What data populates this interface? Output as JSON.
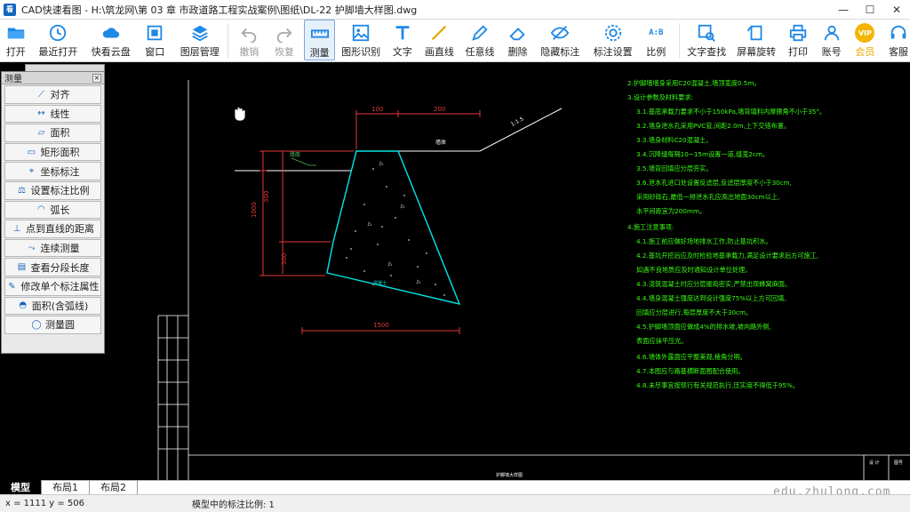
{
  "window": {
    "logo": "看",
    "title": "CAD快速看图 - H:\\筑龙网\\第 03 章 市政道路工程实战案例\\图纸\\DL-22 护脚墙大样图.dwg",
    "min": "—",
    "max": "☐",
    "close": "✕"
  },
  "toolbar": {
    "open": "打开",
    "recent": "最近打开",
    "cloud": "快看云盘",
    "window": "窗口",
    "layers": "图层管理",
    "undo": "撤销",
    "redo": "恢复",
    "measure": "测量",
    "recognize": "图形识别",
    "text": "文字",
    "line": "画直线",
    "freeline": "任意线",
    "delete": "删除",
    "hide_marks": "隐藏标注",
    "mark_settings": "标注设置",
    "scale": "比例",
    "scale_icon_text": "A:B",
    "find_text": "文字查找",
    "rotate": "屏幕旋转",
    "print": "打印",
    "account": "账号",
    "vip": "会员",
    "vip_icon_text": "VIP",
    "service": "客服"
  },
  "measure_panel": {
    "tab_title": "测量",
    "close": "×",
    "items": [
      {
        "label": "对齐",
        "icon": "⟋"
      },
      {
        "label": "线性",
        "icon": "↔"
      },
      {
        "label": "面积",
        "icon": "▱"
      },
      {
        "label": "矩形面积",
        "icon": "▭"
      },
      {
        "label": "坐标标注",
        "icon": "⌖"
      },
      {
        "label": "设置标注比例",
        "icon": "⚖"
      },
      {
        "label": "弧长",
        "icon": "◠"
      },
      {
        "label": "点到直线的距离",
        "icon": "⊥"
      },
      {
        "label": "连续测量",
        "icon": "⤳"
      },
      {
        "label": "查看分段长度",
        "icon": "▤"
      },
      {
        "label": "修改单个标注属性",
        "icon": "✎"
      },
      {
        "label": "面积(含弧线)",
        "icon": "◓"
      },
      {
        "label": "测量圆",
        "icon": "◯"
      }
    ]
  },
  "drawing": {
    "dims": {
      "d1": "100",
      "d2": "200",
      "d3": "300",
      "d4": "1000",
      "d5": "1000",
      "d6": "300",
      "d7": "1500"
    },
    "labels": {
      "l1": "路面",
      "l2": "1:1.5",
      "l3": "墙体",
      "l4": "混凝土"
    },
    "notes": [
      "2.护脚墙墙身采用C20混凝土,墙顶宽度0.5m。",
      "3.设计参数及材料要求:",
      "3.1.基底承载力要求不小于150kPa,墙背填料内摩擦角不小于35°。",
      "3.2.墙身泄水孔采用PVC管,间距2.0m,上下交错布置。",
      "3.3.墙身材料C20混凝土。",
      "3.4.沉降缝每隔10~15m设置一道,缝宽2cm。",
      "3.5.墙背回填应分层夯实。",
      "3.6.泄水孔进口处设置反滤层,反滤层厚度不小于30cm,",
      "    采用砂砾石,最低一排泄水孔应高出地面30cm以上,",
      "    水平间距宜为200mm。",
      "4.施工注意事项:",
      "4.1.施工前应做好场地排水工作,防止基坑积水。",
      "4.2.基坑开挖后应及时检验地基承载力,满足设计要求后方可施工,",
      "    如遇不良地质应及时通知设计单位处理。",
      "4.3.浇筑混凝土时应分层振捣密实,严禁出现蜂窝麻面。",
      "4.4.墙身混凝土强度达到设计强度75%以上方可回填,",
      "    回填应分层进行,每层厚度不大于30cm。",
      "4.5.护脚墙顶面应做成4%的排水坡,坡向路外侧,",
      "    表面应抹平压光。",
      "4.6.墙体外露面应平整美观,棱角分明。",
      "4.7.本图应与路基横断面图配合使用。",
      "4.8.未尽事宜按现行有关规范执行,压实度不得低于95%。"
    ],
    "title_block": "护脚墙大样图",
    "tb1": "设 计",
    "tb2": "图号"
  },
  "tabs": {
    "model": "模型",
    "layout1": "布局1",
    "layout2": "布局2"
  },
  "status": {
    "coords": "x = 1111  y = 506",
    "scale_note": "模型中的标注比例: 1"
  },
  "watermark": "edu.zhulong.com"
}
